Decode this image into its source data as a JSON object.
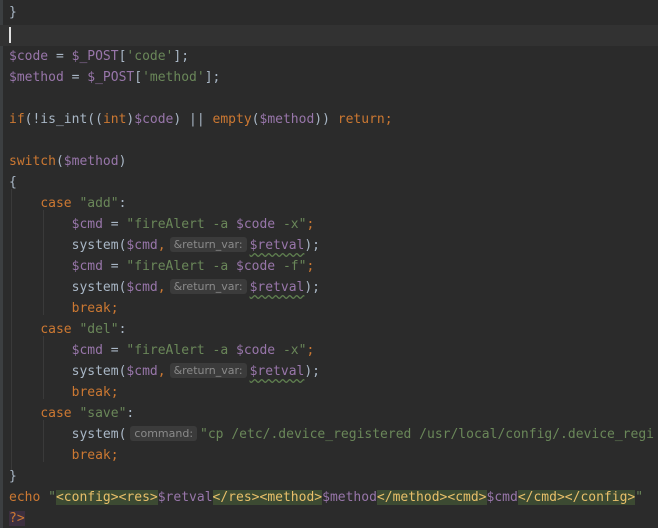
{
  "editor": {
    "colors": {
      "background": "#2b2b2b",
      "keyword": "#cc7832",
      "variable": "#9876aa",
      "string": "#6a8759",
      "default": "#a9b7c6"
    },
    "lines": {
      "l1_brace": "}",
      "l3_var": "$code",
      "l3_assign": " = ",
      "l3_post": "$_POST",
      "l3_key": "'code'",
      "l3_end": "];",
      "l4_var": "$method",
      "l4_key": "'method'",
      "l6_if": "if",
      "l6_fn1": "(!is_int((",
      "l6_cast": "int",
      "l6_close": ")",
      "l6_code": "$code",
      "l6_or": ") || ",
      "l6_empty": "empty",
      "l6_open": "(",
      "l6_method": "$method",
      "l6_close2": ")) ",
      "l6_return": "return",
      "l6_semi": ";",
      "l8_switch": "switch",
      "l8_method": "$method",
      "l9_brace": "{",
      "case": "case",
      "case_add": "\"add\"",
      "case_del": "\"del\"",
      "case_save": "\"save\"",
      "colon": ":",
      "cmd_var": "$cmd",
      "cmd_assign": " = ",
      "cmd_x_pre": "\"fireAlert -a ",
      "cmd_code": "$code",
      "cmd_x_post": " -x\"",
      "cmd_f_post": " -f\"",
      "semi": ";",
      "system_fn": "system",
      "system_open": "(",
      "comma": ",",
      "hint_return_var": "&return_var:",
      "retval": "$retval",
      "system_close": ");",
      "break": "break",
      "hint_command": "command:",
      "cp_str": "\"cp /etc/.device_registered /usr/local/config/.device_regi",
      "close_brace": "}",
      "echo": "echo",
      "echo_q": " \"",
      "tag_config_open": "<config>",
      "tag_res_open": "<res>",
      "tag_res_close": "</res>",
      "tag_method_open": "<method>",
      "tag_method_close": "</method>",
      "tag_cmd_open": "<cmd>",
      "tag_cmd_close": "</cmd>",
      "tag_config_close": "</config>",
      "echo_end": "\"",
      "php_close": "?>"
    }
  }
}
